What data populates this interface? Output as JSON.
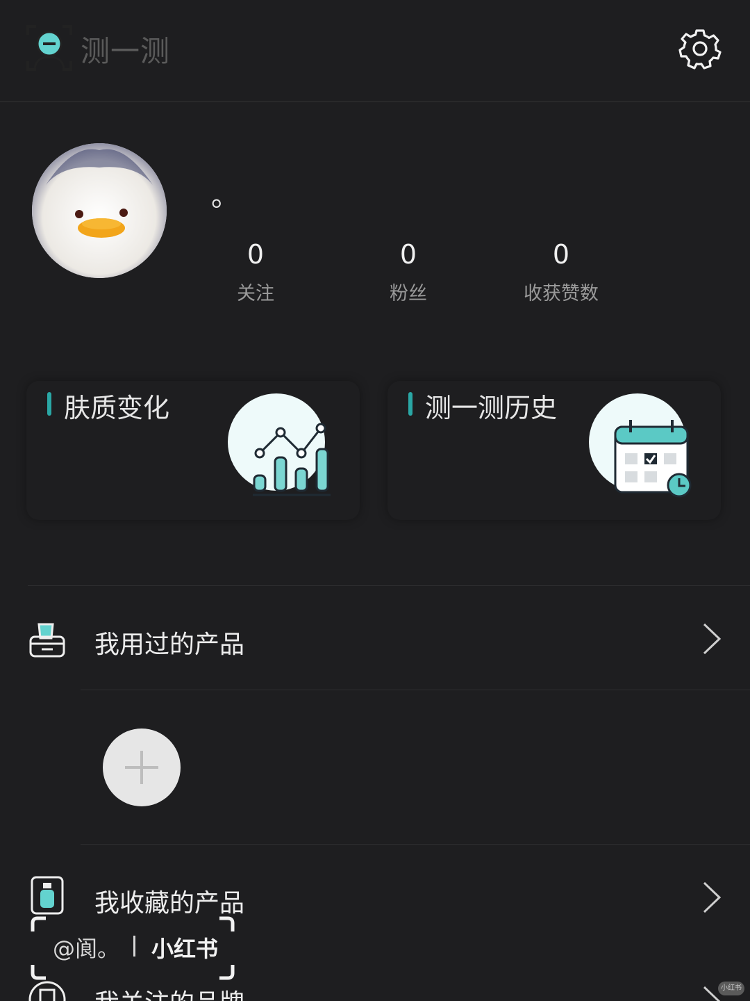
{
  "header": {
    "title": "测一测",
    "scan_icon": "face-scan-icon",
    "settings_icon": "gear-icon"
  },
  "profile": {
    "nickname": "。",
    "avatar": "fluffy-duck-avatar",
    "stats": [
      {
        "value": "0",
        "label": "关注"
      },
      {
        "value": "0",
        "label": "粉丝"
      },
      {
        "value": "0",
        "label": "收获赞数"
      }
    ]
  },
  "cards": [
    {
      "title": "肤质变化",
      "icon": "bar-line-chart-icon"
    },
    {
      "title": "测一测历史",
      "icon": "calendar-clock-icon"
    }
  ],
  "lists": {
    "used_products": {
      "label": "我用过的产品",
      "icon": "product-box-icon"
    },
    "fav_products": {
      "label": "我收藏的产品",
      "icon": "bottle-icon"
    },
    "followed_brands": {
      "label": "我关注的品牌",
      "icon": "brand-icon"
    }
  },
  "add_icon": "plus-icon",
  "watermark": {
    "handle": "@阆。",
    "brand": "小红书",
    "badge": "小红书"
  },
  "colors": {
    "background": "#1e1e20",
    "accent": "#2aa7a5",
    "accent_light": "#6fd3cf",
    "illustration_bg": "#eefafa"
  }
}
